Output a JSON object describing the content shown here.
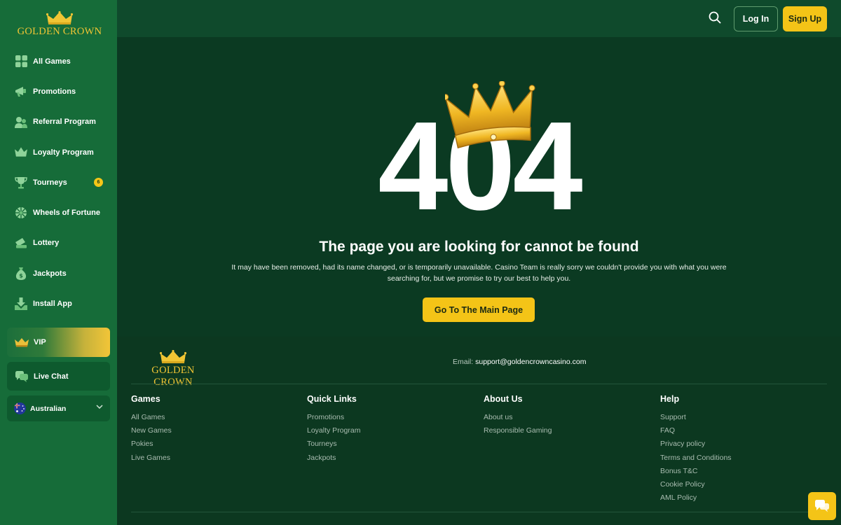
{
  "brand": {
    "name": "GOLDEN CROWN",
    "accent": "#f4c417",
    "sidebar_bg": "#166c39",
    "main_bg": "#0b3a22"
  },
  "sidebar": {
    "items": [
      {
        "label": "All Games",
        "icon": "grid-icon"
      },
      {
        "label": "Promotions",
        "icon": "megaphone-icon"
      },
      {
        "label": "Referral Program",
        "icon": "users-icon"
      },
      {
        "label": "Loyalty Program",
        "icon": "crown-icon"
      },
      {
        "label": "Tourneys",
        "icon": "trophy-icon",
        "badge": "6"
      },
      {
        "label": "Wheels of Fortune",
        "icon": "wheel-icon"
      },
      {
        "label": "Lottery",
        "icon": "ticket-icon"
      },
      {
        "label": "Jackpots",
        "icon": "money-bag-icon"
      },
      {
        "label": "Install App",
        "icon": "download-icon"
      }
    ],
    "vip_label": "VIP",
    "live_chat_label": "Live Chat",
    "language_label": "Australian"
  },
  "header": {
    "login_label": "Log In",
    "signup_label": "Sign Up"
  },
  "main": {
    "code": "404",
    "title": "The page you are looking for cannot be found",
    "description": "It may have been removed, had its name changed, or is temporarily unavailable. Casino Team is really sorry we couldn't provide you with what you were searching for, but we promise to try our best to help you.",
    "button_label": "Go To The Main Page"
  },
  "footer": {
    "email_label": "Email:",
    "email_value": "support@goldencrowncasino.com",
    "columns": [
      {
        "title": "Games",
        "links": [
          "All Games",
          "New Games",
          "Pokies",
          "Live Games"
        ]
      },
      {
        "title": "Quick Links",
        "links": [
          "Promotions",
          "Loyalty Program",
          "Tourneys",
          "Jackpots"
        ]
      },
      {
        "title": "About Us",
        "links": [
          "About us",
          "Responsible Gaming"
        ]
      },
      {
        "title": "Help",
        "links": [
          "Support",
          "FAQ",
          "Privacy policy",
          "Terms and Conditions",
          "Bonus T&C",
          "Cookie Policy",
          "AML Policy"
        ]
      }
    ]
  }
}
